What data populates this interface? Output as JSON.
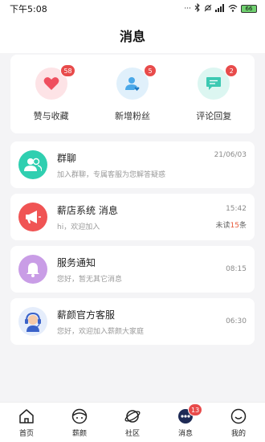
{
  "status": {
    "time": "下午5:08",
    "icons": [
      "dots-icon",
      "bluetooth-icon",
      "mute-icon",
      "signal-icon",
      "wifi-icon"
    ],
    "battery": "66"
  },
  "header": {
    "title": "消息"
  },
  "top_tiles": [
    {
      "label": "赞与收藏",
      "badge": "58",
      "icon": "heart-icon",
      "color": "#ef4f5f"
    },
    {
      "label": "新增粉丝",
      "badge": "5",
      "icon": "user-plus-icon",
      "color": "#4aa8e8"
    },
    {
      "label": "评论回复",
      "badge": "2",
      "icon": "comment-icon",
      "color": "#3cc9b2"
    }
  ],
  "messages": [
    {
      "title": "群聊",
      "subtitle": "加入群聊，专属客服为您解答疑惑",
      "time": "21/06/03",
      "icon": "group-icon",
      "color": "#2fcfb0"
    },
    {
      "title": "薪店系统 消息",
      "subtitle": "hi，欢迎加入",
      "time": "15:42",
      "unread_prefix": "未读",
      "unread_count": "15",
      "unread_suffix": "条",
      "icon": "megaphone-icon",
      "color": "#f05454"
    },
    {
      "title": "服务通知",
      "subtitle": "您好，暂无其它消息",
      "time": "08:15",
      "icon": "bell-icon",
      "color": "#c99de6"
    },
    {
      "title": "薪颜官方客服",
      "subtitle": "您好，欢迎加入薪颜大家庭",
      "time": "06:30",
      "icon": "headset-agent-icon",
      "color": "#3a62c9"
    }
  ],
  "tabs": [
    {
      "label": "首页",
      "icon": "home-icon"
    },
    {
      "label": "薪颜",
      "icon": "face-icon"
    },
    {
      "label": "社区",
      "icon": "planet-icon"
    },
    {
      "label": "消息",
      "icon": "chat-icon",
      "badge": "13"
    },
    {
      "label": "我的",
      "icon": "smile-icon"
    }
  ],
  "colors": {
    "accent": "#e84b4b",
    "background": "#f4f4f6"
  }
}
